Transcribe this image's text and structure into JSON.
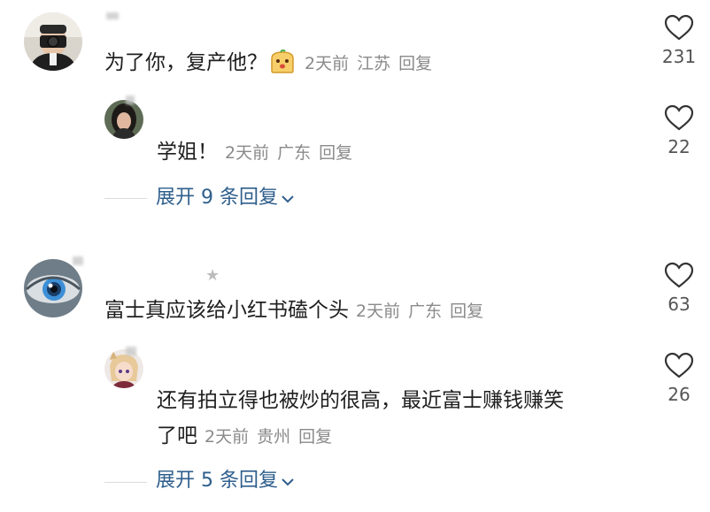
{
  "comments": [
    {
      "name": "",
      "text": "为了你，复产他？",
      "time": "2天前",
      "location": "江苏",
      "reply": "回复",
      "likes": "231",
      "avatar": "photographer-avatar"
    },
    {
      "name": "",
      "text": "学姐！",
      "time": "2天前",
      "location": "广东",
      "reply": "回复",
      "likes": "22",
      "avatar": "girl-avatar"
    },
    {
      "name": "",
      "text": "富士真应该给小红书磕个头",
      "time": "2天前",
      "location": "广东",
      "reply": "回复",
      "likes": "63",
      "avatar": "eye-avatar"
    },
    {
      "name": "",
      "text_line1": "还有拍立得也被炒的很高，最近富士赚钱赚笑",
      "text_line2": "了吧",
      "time": "2天前",
      "location": "贵州",
      "reply": "回复",
      "likes": "26",
      "avatar": "anime-avatar"
    }
  ],
  "expand_1": "展开 9 条回复",
  "expand_2": "展开 5 条回复",
  "colors": {
    "link": "#2e5e8c",
    "meta": "#8a8a8a",
    "text": "#1f1f1f"
  }
}
